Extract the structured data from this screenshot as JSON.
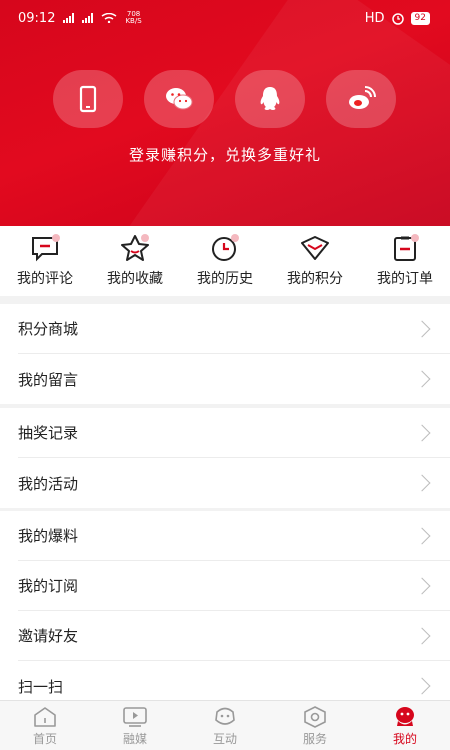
{
  "status_bar": {
    "time": "09:12",
    "signal1": "4G",
    "signal2": "2G",
    "net_speed_value": "708",
    "net_speed_unit": "KB/S",
    "hd": "HD",
    "battery": "92"
  },
  "header": {
    "login_methods": [
      {
        "name": "phone",
        "icon": "phone-icon"
      },
      {
        "name": "wechat",
        "icon": "wechat-icon"
      },
      {
        "name": "qq",
        "icon": "qq-icon"
      },
      {
        "name": "weibo",
        "icon": "weibo-icon"
      }
    ],
    "login_tip": "登录赚积分，兑换多重好礼"
  },
  "quick_actions": [
    {
      "label": "我的评论",
      "icon": "comment-icon"
    },
    {
      "label": "我的收藏",
      "icon": "star-icon"
    },
    {
      "label": "我的历史",
      "icon": "clock-icon"
    },
    {
      "label": "我的积分",
      "icon": "points-icon"
    },
    {
      "label": "我的订单",
      "icon": "order-icon"
    }
  ],
  "menu_groups": [
    {
      "items": [
        "积分商城",
        "我的留言"
      ]
    },
    {
      "items": [
        "抽奖记录",
        "我的活动"
      ]
    },
    {
      "items": [
        "我的爆料",
        "我的订阅",
        "邀请好友",
        "扫一扫"
      ]
    }
  ],
  "tabbar": {
    "tabs": [
      {
        "label": "首页",
        "icon": "home-icon"
      },
      {
        "label": "融媒",
        "icon": "media-icon"
      },
      {
        "label": "互动",
        "icon": "interact-icon"
      },
      {
        "label": "服务",
        "icon": "service-icon"
      },
      {
        "label": "我的",
        "icon": "mine-icon"
      }
    ],
    "active_index": 4
  },
  "colors": {
    "brand_red": "#d6061c",
    "inactive_tab": "#999999",
    "icon_badge": "#f4b8bf"
  }
}
